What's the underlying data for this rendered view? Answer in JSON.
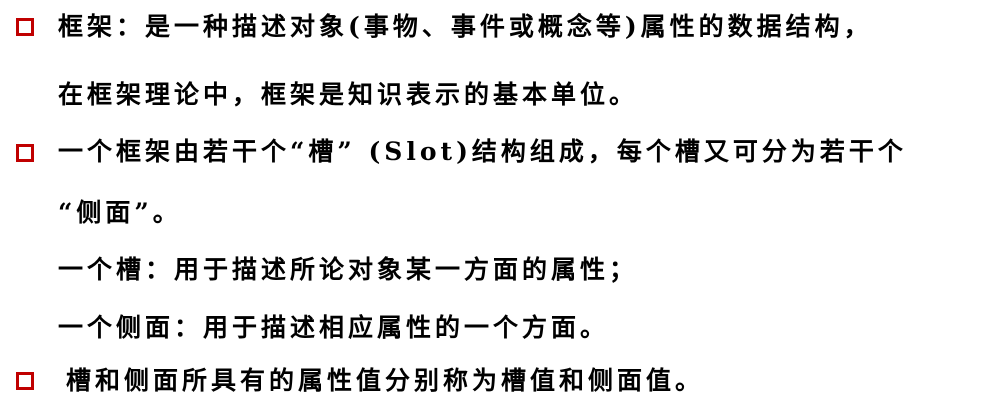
{
  "bullet_color": "#c00000",
  "items": [
    {
      "lines": [
        "框架：是一种描述对象(事物、事件或概念等)属性的数据结构，",
        "在框架理论中，框架是知识表示的基本单位。"
      ]
    },
    {
      "lines": [
        "一个框架由若干个“槽” (Slot)结构组成，每个槽又可分为若干个",
        "“侧面”。"
      ]
    },
    {
      "lines": [
        "一个槽：用于描述所论对象某一方面的属性；",
        "一个侧面：用于描述相应属性的一个方面。"
      ]
    },
    {
      "lines": [
        "槽和侧面所具有的属性值分别称为槽值和侧面值。"
      ]
    }
  ]
}
